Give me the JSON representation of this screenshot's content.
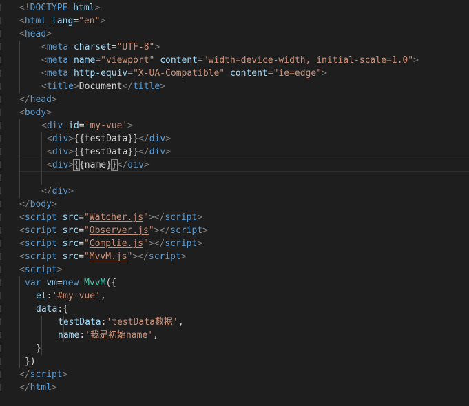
{
  "editor": {
    "colors": {
      "background": "#1e1e1e",
      "tag": "#569cd6",
      "attribute": "#9cdcfe",
      "string": "#ce9178",
      "text": "#d4d4d4",
      "punctuation": "#808080",
      "class": "#4ec9b0"
    },
    "lines": [
      {
        "indent": 0,
        "tokens": [
          [
            "p",
            "<!"
          ],
          [
            "tag",
            "DOCTYPE"
          ],
          [
            "text",
            " "
          ],
          [
            "attr",
            "html"
          ],
          [
            "p",
            ">"
          ]
        ]
      },
      {
        "indent": 0,
        "tokens": [
          [
            "p",
            "<"
          ],
          [
            "tag",
            "html"
          ],
          [
            "text",
            " "
          ],
          [
            "attr",
            "lang"
          ],
          [
            "text",
            "="
          ],
          [
            "str",
            "\"en\""
          ],
          [
            "p",
            ">"
          ]
        ]
      },
      {
        "indent": 0,
        "tokens": [
          [
            "p",
            "<"
          ],
          [
            "tag",
            "head"
          ],
          [
            "p",
            ">"
          ]
        ]
      },
      {
        "indent": 4,
        "tokens": [
          [
            "p",
            "<"
          ],
          [
            "tag",
            "meta"
          ],
          [
            "text",
            " "
          ],
          [
            "attr",
            "charset"
          ],
          [
            "text",
            "="
          ],
          [
            "str",
            "\"UTF-8\""
          ],
          [
            "p",
            ">"
          ]
        ]
      },
      {
        "indent": 4,
        "tokens": [
          [
            "p",
            "<"
          ],
          [
            "tag",
            "meta"
          ],
          [
            "text",
            " "
          ],
          [
            "attr",
            "name"
          ],
          [
            "text",
            "="
          ],
          [
            "str",
            "\"viewport\""
          ],
          [
            "text",
            " "
          ],
          [
            "attr",
            "content"
          ],
          [
            "text",
            "="
          ],
          [
            "str",
            "\"width=device-width, initial-scale=1.0\""
          ],
          [
            "p",
            ">"
          ]
        ]
      },
      {
        "indent": 4,
        "tokens": [
          [
            "p",
            "<"
          ],
          [
            "tag",
            "meta"
          ],
          [
            "text",
            " "
          ],
          [
            "attr",
            "http-equiv"
          ],
          [
            "text",
            "="
          ],
          [
            "str",
            "\"X-UA-Compatible\""
          ],
          [
            "text",
            " "
          ],
          [
            "attr",
            "content"
          ],
          [
            "text",
            "="
          ],
          [
            "str",
            "\"ie=edge\""
          ],
          [
            "p",
            ">"
          ]
        ]
      },
      {
        "indent": 4,
        "tokens": [
          [
            "p",
            "<"
          ],
          [
            "tag",
            "title"
          ],
          [
            "p",
            ">"
          ],
          [
            "text",
            "Document"
          ],
          [
            "p",
            "</"
          ],
          [
            "tag",
            "title"
          ],
          [
            "p",
            ">"
          ]
        ]
      },
      {
        "indent": 0,
        "tokens": [
          [
            "p",
            "</"
          ],
          [
            "tag",
            "head"
          ],
          [
            "p",
            ">"
          ]
        ]
      },
      {
        "indent": 0,
        "tokens": [
          [
            "p",
            "<"
          ],
          [
            "tag",
            "body"
          ],
          [
            "p",
            ">"
          ]
        ]
      },
      {
        "indent": 4,
        "tokens": [
          [
            "p",
            "<"
          ],
          [
            "tag",
            "div"
          ],
          [
            "text",
            " "
          ],
          [
            "attr",
            "id"
          ],
          [
            "text",
            "="
          ],
          [
            "str",
            "'my-vue'"
          ],
          [
            "p",
            ">"
          ]
        ]
      },
      {
        "indent": 5,
        "tokens": [
          [
            "p",
            "<"
          ],
          [
            "tag",
            "div"
          ],
          [
            "p",
            ">"
          ],
          [
            "text",
            "{{testData}}"
          ],
          [
            "p",
            "</"
          ],
          [
            "tag",
            "div"
          ],
          [
            "p",
            ">"
          ]
        ]
      },
      {
        "indent": 5,
        "tokens": [
          [
            "p",
            "<"
          ],
          [
            "tag",
            "div"
          ],
          [
            "p",
            ">"
          ],
          [
            "text",
            "{{testData}}"
          ],
          [
            "p",
            "</"
          ],
          [
            "tag",
            "div"
          ],
          [
            "p",
            ">"
          ]
        ]
      },
      {
        "indent": 5,
        "current": true,
        "tokens": [
          [
            "p",
            "<"
          ],
          [
            "tag",
            "div"
          ],
          [
            "p",
            ">"
          ],
          [
            "caret",
            "{"
          ],
          [
            "text",
            "{name}"
          ],
          [
            "caret",
            "}"
          ],
          [
            "p",
            "</"
          ],
          [
            "tag",
            "div"
          ],
          [
            "p",
            ">"
          ]
        ]
      },
      {
        "indent": 0,
        "tokens": []
      },
      {
        "indent": 4,
        "tokens": [
          [
            "p",
            "</"
          ],
          [
            "tag",
            "div"
          ],
          [
            "p",
            ">"
          ]
        ]
      },
      {
        "indent": 0,
        "tokens": [
          [
            "p",
            "</"
          ],
          [
            "tag",
            "body"
          ],
          [
            "p",
            ">"
          ]
        ]
      },
      {
        "indent": 0,
        "tokens": [
          [
            "p",
            "<"
          ],
          [
            "tag",
            "script"
          ],
          [
            "text",
            " "
          ],
          [
            "attr",
            "src"
          ],
          [
            "text",
            "="
          ],
          [
            "str",
            "\""
          ],
          [
            "link",
            "Watcher.js"
          ],
          [
            "str",
            "\""
          ],
          [
            "p",
            "></"
          ],
          [
            "tag",
            "script"
          ],
          [
            "p",
            ">"
          ]
        ]
      },
      {
        "indent": 0,
        "tokens": [
          [
            "p",
            "<"
          ],
          [
            "tag",
            "script"
          ],
          [
            "text",
            " "
          ],
          [
            "attr",
            "src"
          ],
          [
            "text",
            "="
          ],
          [
            "str",
            "\""
          ],
          [
            "link",
            "Observer.js"
          ],
          [
            "str",
            "\""
          ],
          [
            "p",
            "></"
          ],
          [
            "tag",
            "script"
          ],
          [
            "p",
            ">"
          ]
        ]
      },
      {
        "indent": 0,
        "tokens": [
          [
            "p",
            "<"
          ],
          [
            "tag",
            "script"
          ],
          [
            "text",
            " "
          ],
          [
            "attr",
            "src"
          ],
          [
            "text",
            "="
          ],
          [
            "str",
            "\""
          ],
          [
            "link",
            "Complie.js"
          ],
          [
            "str",
            "\""
          ],
          [
            "p",
            "></"
          ],
          [
            "tag",
            "script"
          ],
          [
            "p",
            ">"
          ]
        ]
      },
      {
        "indent": 0,
        "tokens": [
          [
            "p",
            "<"
          ],
          [
            "tag",
            "script"
          ],
          [
            "text",
            " "
          ],
          [
            "attr",
            "src"
          ],
          [
            "text",
            "="
          ],
          [
            "str",
            "\""
          ],
          [
            "link",
            "MvvM.js"
          ],
          [
            "str",
            "\""
          ],
          [
            "p",
            "></"
          ],
          [
            "tag",
            "script"
          ],
          [
            "p",
            ">"
          ]
        ]
      },
      {
        "indent": 0,
        "tokens": [
          [
            "p",
            "<"
          ],
          [
            "tag",
            "script"
          ],
          [
            "p",
            ">"
          ]
        ]
      },
      {
        "indent": 1,
        "tokens": [
          [
            "kw",
            "var"
          ],
          [
            "text",
            " "
          ],
          [
            "var",
            "vm"
          ],
          [
            "text",
            "="
          ],
          [
            "kw",
            "new"
          ],
          [
            "text",
            " "
          ],
          [
            "cls",
            "MvvM"
          ],
          [
            "text",
            "({"
          ]
        ]
      },
      {
        "indent": 3,
        "tokens": [
          [
            "var",
            "el"
          ],
          [
            "text",
            ":"
          ],
          [
            "str",
            "'#my-vue'"
          ],
          [
            "text",
            ","
          ]
        ]
      },
      {
        "indent": 3,
        "tokens": [
          [
            "var",
            "data"
          ],
          [
            "text",
            ":{"
          ]
        ]
      },
      {
        "indent": 7,
        "tokens": [
          [
            "var",
            "testData"
          ],
          [
            "text",
            ":"
          ],
          [
            "str",
            "'testData数据'"
          ],
          [
            "text",
            ","
          ]
        ]
      },
      {
        "indent": 7,
        "tokens": [
          [
            "var",
            "name"
          ],
          [
            "text",
            ":"
          ],
          [
            "str",
            "'我是初始name'"
          ],
          [
            "text",
            ","
          ]
        ]
      },
      {
        "indent": 3,
        "tokens": [
          [
            "text",
            "}"
          ]
        ]
      },
      {
        "indent": 1,
        "tokens": [
          [
            "text",
            "})"
          ]
        ]
      },
      {
        "indent": 0,
        "tokens": [
          [
            "p",
            "</"
          ],
          [
            "tag",
            "script"
          ],
          [
            "p",
            ">"
          ]
        ]
      },
      {
        "indent": 0,
        "tokens": [
          [
            "p",
            "</"
          ],
          [
            "tag",
            "html"
          ],
          [
            "p",
            ">"
          ]
        ]
      }
    ]
  }
}
